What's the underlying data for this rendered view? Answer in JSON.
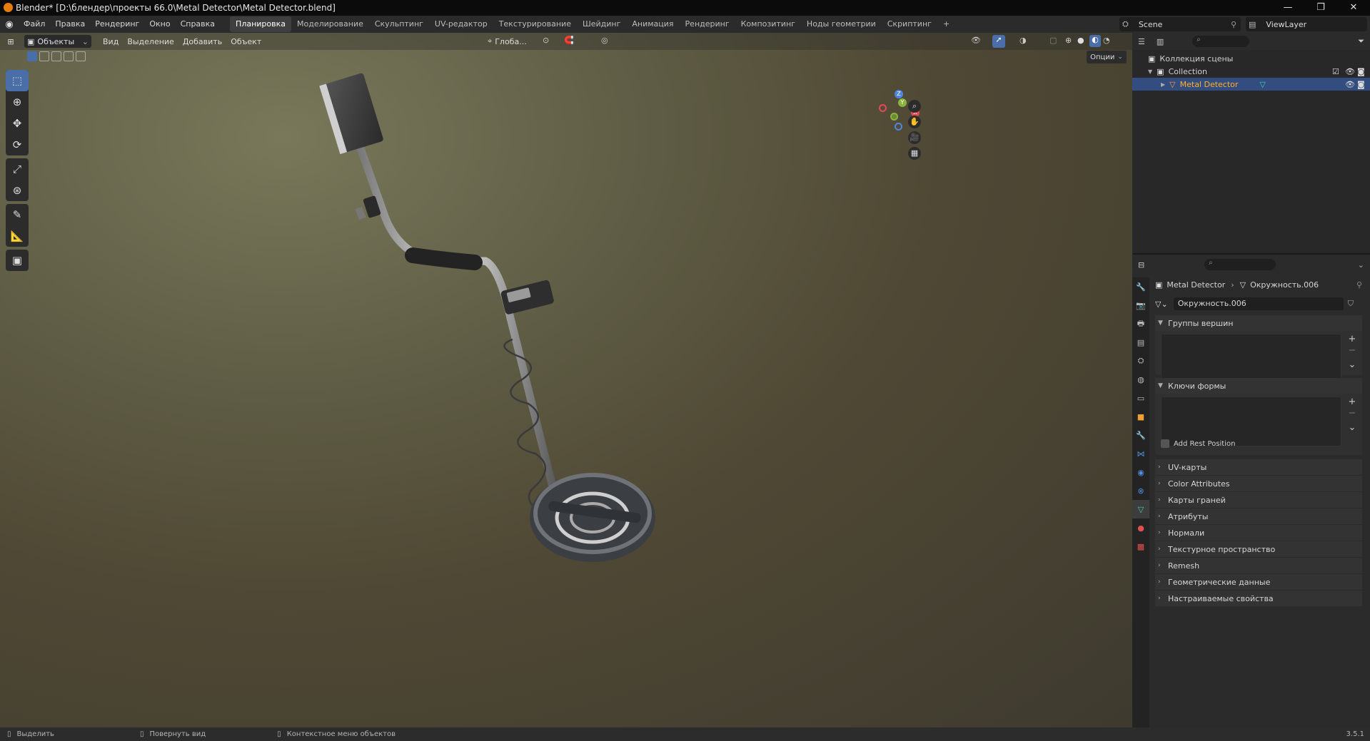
{
  "window": {
    "title": "Blender* [D:\\блендер\\проекты 66.0\\Metal Detector\\Metal Detector.blend]",
    "controls": [
      "—",
      "❐",
      "✕"
    ]
  },
  "menu": [
    "Файл",
    "Правка",
    "Рендеринг",
    "Окно",
    "Справка"
  ],
  "workspaces": [
    "Планировка",
    "Моделирование",
    "Скульптинг",
    "UV-редактор",
    "Текстурирование",
    "Шейдинг",
    "Анимация",
    "Рендеринг",
    "Композитинг",
    "Ноды геометрии",
    "Скриптинг",
    "+"
  ],
  "scene": {
    "name": "Scene",
    "view_layer": "ViewLayer"
  },
  "viewport": {
    "mode": "Объекты",
    "menus": [
      "Вид",
      "Выделение",
      "Добавить",
      "Объект"
    ],
    "orientation": "Глоба...",
    "options_label": "Опции",
    "gizmo_axes": {
      "x": "X",
      "y": "Y",
      "z": "Z"
    }
  },
  "outliner": {
    "scene_collection": "Коллекция сцены",
    "collection": "Collection",
    "object": "Metal Detector"
  },
  "properties": {
    "breadcrumb_object": "Metal Detector",
    "breadcrumb_mesh": "Окружность.006",
    "mesh_name": "Окружность.006",
    "panels": {
      "vertex_groups": "Группы вершин",
      "shape_keys": "Ключи формы",
      "add_rest_position": "Add Rest Position"
    },
    "collapsed_panels": [
      "UV-карты",
      "Color Attributes",
      "Карты граней",
      "Атрибуты",
      "Нормали",
      "Текстурное пространство",
      "Remesh",
      "Геометрические данные",
      "Настраиваемые свойства"
    ]
  },
  "status": {
    "select": "Выделить",
    "rotate": "Повернуть вид",
    "context": "Контекстное меню объектов",
    "version": "3.5.1"
  },
  "colors": {
    "accent": "#4a6ea8",
    "selection": "#334d80",
    "object_highlight": "#ffaf29"
  }
}
